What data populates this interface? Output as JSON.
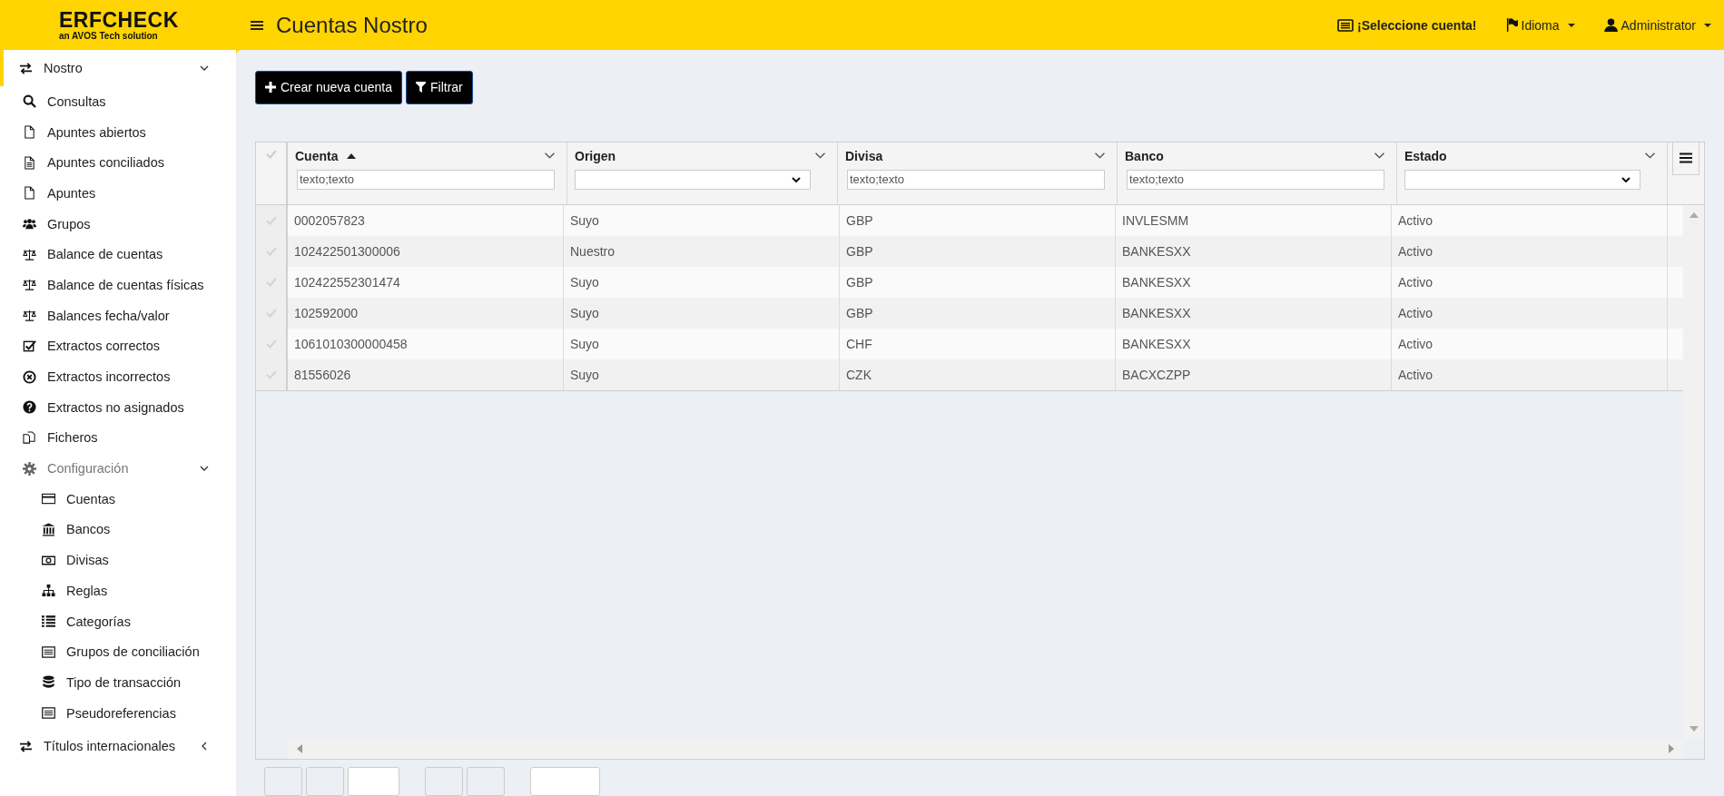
{
  "header": {
    "logo": "ERFCHECK",
    "logo_tagline": "an AVOS Tech solution",
    "page_title": "Cuentas Nostro",
    "account_selector": "¡Seleccione cuenta!",
    "language_menu": "Idioma",
    "user_menu": "Administrator"
  },
  "sidebar": {
    "items": [
      {
        "label": "Nostro",
        "selected": true,
        "expanded": true,
        "children": [
          {
            "label": "Consultas"
          },
          {
            "label": "Apuntes abiertos"
          },
          {
            "label": "Apuntes conciliados"
          },
          {
            "label": "Apuntes"
          },
          {
            "label": "Grupos"
          },
          {
            "label": "Balance de cuentas"
          },
          {
            "label": "Balance de cuentas físicas"
          },
          {
            "label": "Balances fecha/valor"
          },
          {
            "label": "Extractos correctos"
          },
          {
            "label": "Extractos incorrectos"
          },
          {
            "label": "Extractos no asignados"
          },
          {
            "label": "Ficheros"
          },
          {
            "label": "Configuración",
            "expanded": true,
            "children": [
              {
                "label": "Cuentas"
              },
              {
                "label": "Bancos"
              },
              {
                "label": "Divisas"
              },
              {
                "label": "Reglas"
              },
              {
                "label": "Categorías"
              },
              {
                "label": "Grupos de conciliación"
              },
              {
                "label": "Tipo de transacción"
              },
              {
                "label": "Pseudoreferencias"
              }
            ]
          }
        ]
      },
      {
        "label": "Títulos internacionales",
        "selected": false,
        "expanded": false
      }
    ]
  },
  "toolbar": {
    "buttons": [
      {
        "label": "Crear nueva cuenta",
        "kind": "create"
      },
      {
        "label": "Filtrar",
        "kind": "filter"
      }
    ]
  },
  "table": {
    "columns": [
      {
        "label": "Cuenta",
        "sorted": true,
        "filter": {
          "kind": "text",
          "placeholder": "texto;texto"
        }
      },
      {
        "label": "Origen",
        "sorted": false,
        "filter": {
          "kind": "select"
        }
      },
      {
        "label": "Divisa",
        "sorted": false,
        "filter": {
          "kind": "text",
          "placeholder": "texto;texto"
        }
      },
      {
        "label": "Banco",
        "sorted": false,
        "filter": {
          "kind": "text",
          "placeholder": "texto;texto"
        }
      },
      {
        "label": "Estado",
        "sorted": false,
        "filter": {
          "kind": "select"
        }
      }
    ],
    "rows": [
      {
        "selected": false,
        "cells": [
          "0002057823",
          "Suyo",
          "GBP",
          "INVLESMM",
          "Activo"
        ]
      },
      {
        "selected": false,
        "cells": [
          "102422501300006",
          "Nuestro",
          "GBP",
          "BANKESXX",
          "Activo"
        ]
      },
      {
        "selected": false,
        "cells": [
          "102422552301474",
          "Suyo",
          "GBP",
          "BANKESXX",
          "Activo"
        ]
      },
      {
        "selected": false,
        "cells": [
          "102592000",
          "Suyo",
          "GBP",
          "BANKESXX",
          "Activo"
        ]
      },
      {
        "selected": false,
        "cells": [
          "1061010300000458",
          "Suyo",
          "CHF",
          "BANKESXX",
          "Activo"
        ]
      },
      {
        "selected": false,
        "cells": [
          "81556026",
          "Suyo",
          "CZK",
          "BACXCZPP",
          "Activo"
        ]
      }
    ]
  }
}
